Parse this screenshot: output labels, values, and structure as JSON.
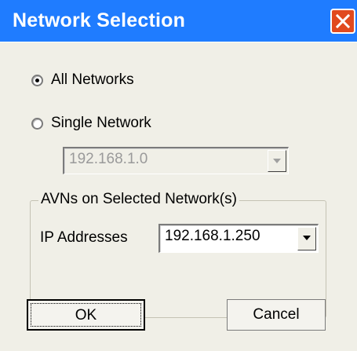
{
  "window": {
    "title": "Network Selection",
    "colors": {
      "titlebar": "#1f7cff",
      "close": "#e14a1f",
      "client": "#f0efe7"
    }
  },
  "options": {
    "all_networks_label": "All Networks",
    "all_networks_selected": true,
    "single_network_label": "Single Network",
    "single_network_selected": false,
    "network_combo_value": "192.168.1.0",
    "network_combo_enabled": false
  },
  "group": {
    "label": "AVNs on Selected Network(s)",
    "ip_label": "IP Addresses",
    "ip_value": "192.168.1.250"
  },
  "buttons": {
    "ok": "OK",
    "cancel": "Cancel"
  },
  "icons": {
    "close": "close-icon",
    "dropdown": "chevron-down-icon"
  }
}
